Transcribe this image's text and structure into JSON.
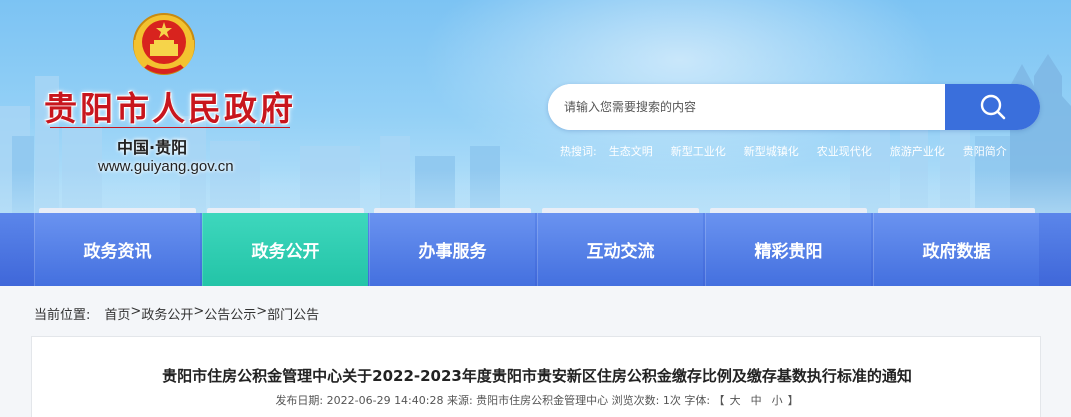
{
  "header": {
    "site_title": "贵阳市人民政府",
    "site_subtitle": "中国·贵阳",
    "site_url": "www.guiyang.gov.cn"
  },
  "search": {
    "placeholder": "请输入您需要搜索的内容",
    "value": ""
  },
  "hot_search": {
    "label": "热搜词:",
    "terms": [
      "生态文明",
      "新型工业化",
      "新型城镇化",
      "农业现代化",
      "旅游产业化",
      "贵阳简介"
    ]
  },
  "nav": {
    "items": [
      {
        "label": "政务资讯",
        "active": false
      },
      {
        "label": "政务公开",
        "active": true
      },
      {
        "label": "办事服务",
        "active": false
      },
      {
        "label": "互动交流",
        "active": false
      },
      {
        "label": "精彩贵阳",
        "active": false
      },
      {
        "label": "政府数据",
        "active": false
      }
    ]
  },
  "breadcrumb": {
    "label": "当前位置:",
    "items": [
      "首页",
      "政务公开",
      "公告公示",
      "部门公告"
    ],
    "separator": ">"
  },
  "article": {
    "title": "贵阳市住房公积金管理中心关于2022-2023年度贵阳市贵安新区住房公积金缴存比例及缴存基数执行标准的通知",
    "meta_prefix": "发布日期: 2022-06-29 14:40:28 来源: 贵阳市住房公积金管理中心 浏览次数: 1次 字体: 【",
    "font_large": "大",
    "font_medium": "中",
    "font_small": "小",
    "meta_suffix": "】"
  },
  "colors": {
    "title_red": "#c8161d",
    "nav_blue": "#4470df",
    "nav_active": "#23c4a7",
    "search_button": "#3a6fdc"
  }
}
